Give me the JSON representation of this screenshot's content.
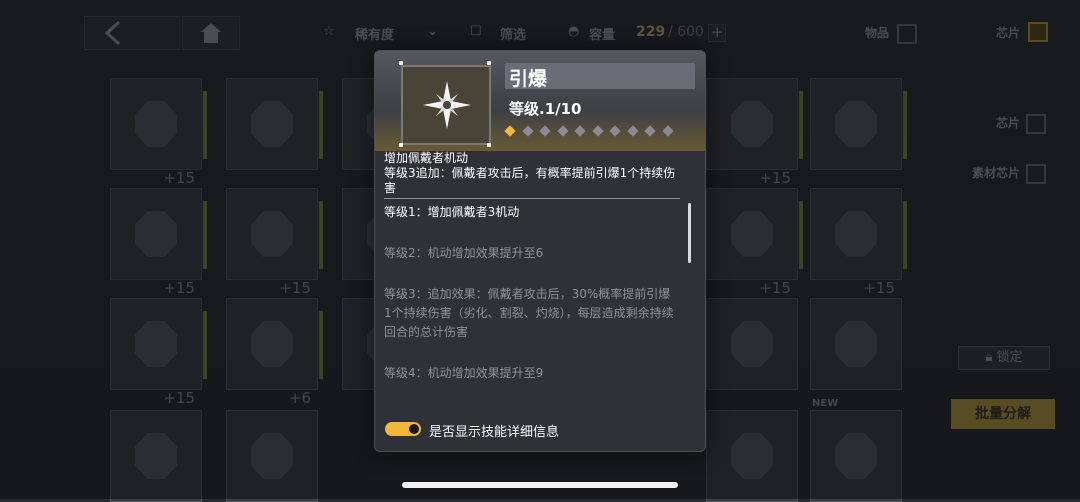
{
  "topbar": {
    "back_icon": "chevron-left-icon",
    "home_icon": "home-icon",
    "rarity_label": "稀有度",
    "filter_label": "筛选",
    "capacity_label": "容量",
    "capacity_current": "229",
    "capacity_max": "/ 600",
    "add_icon": "plus-icon"
  },
  "side": {
    "items_label": "物品",
    "chip_label_top": "芯片",
    "chip_label": "芯片",
    "material_chip_label": "素材芯片",
    "lock_label": "锁定",
    "batch_label": "批量分解"
  },
  "grid": {
    "plus_labels": [
      "+15",
      "+15",
      "+15",
      "+15",
      "+15",
      "+15",
      "+6",
      "+15"
    ],
    "new_label": "NEW"
  },
  "popup": {
    "skill_name": "引爆",
    "level_text": "等级.1/10",
    "level_current": 1,
    "level_max": 10,
    "summary_line1": "增加佩戴者机动",
    "summary_line2": "等级3追加：佩戴者攻击后，有概率提前引爆1个持续伤害",
    "levels": [
      "等级1：增加佩戴者3机动",
      "等级2：机动增加效果提升至6",
      "等级3：追加效果：佩戴者攻击后，30%概率提前引爆1个持续伤害（劣化、割裂、灼烧），每层造成剩余持续回合的总计伤害",
      "等级4：机动增加效果提升至9"
    ],
    "toggle_label": "是否显示技能详细信息",
    "toggle_on": true
  },
  "colors": {
    "accent": "#f0b73a",
    "pip_off": "#8a8c92"
  }
}
